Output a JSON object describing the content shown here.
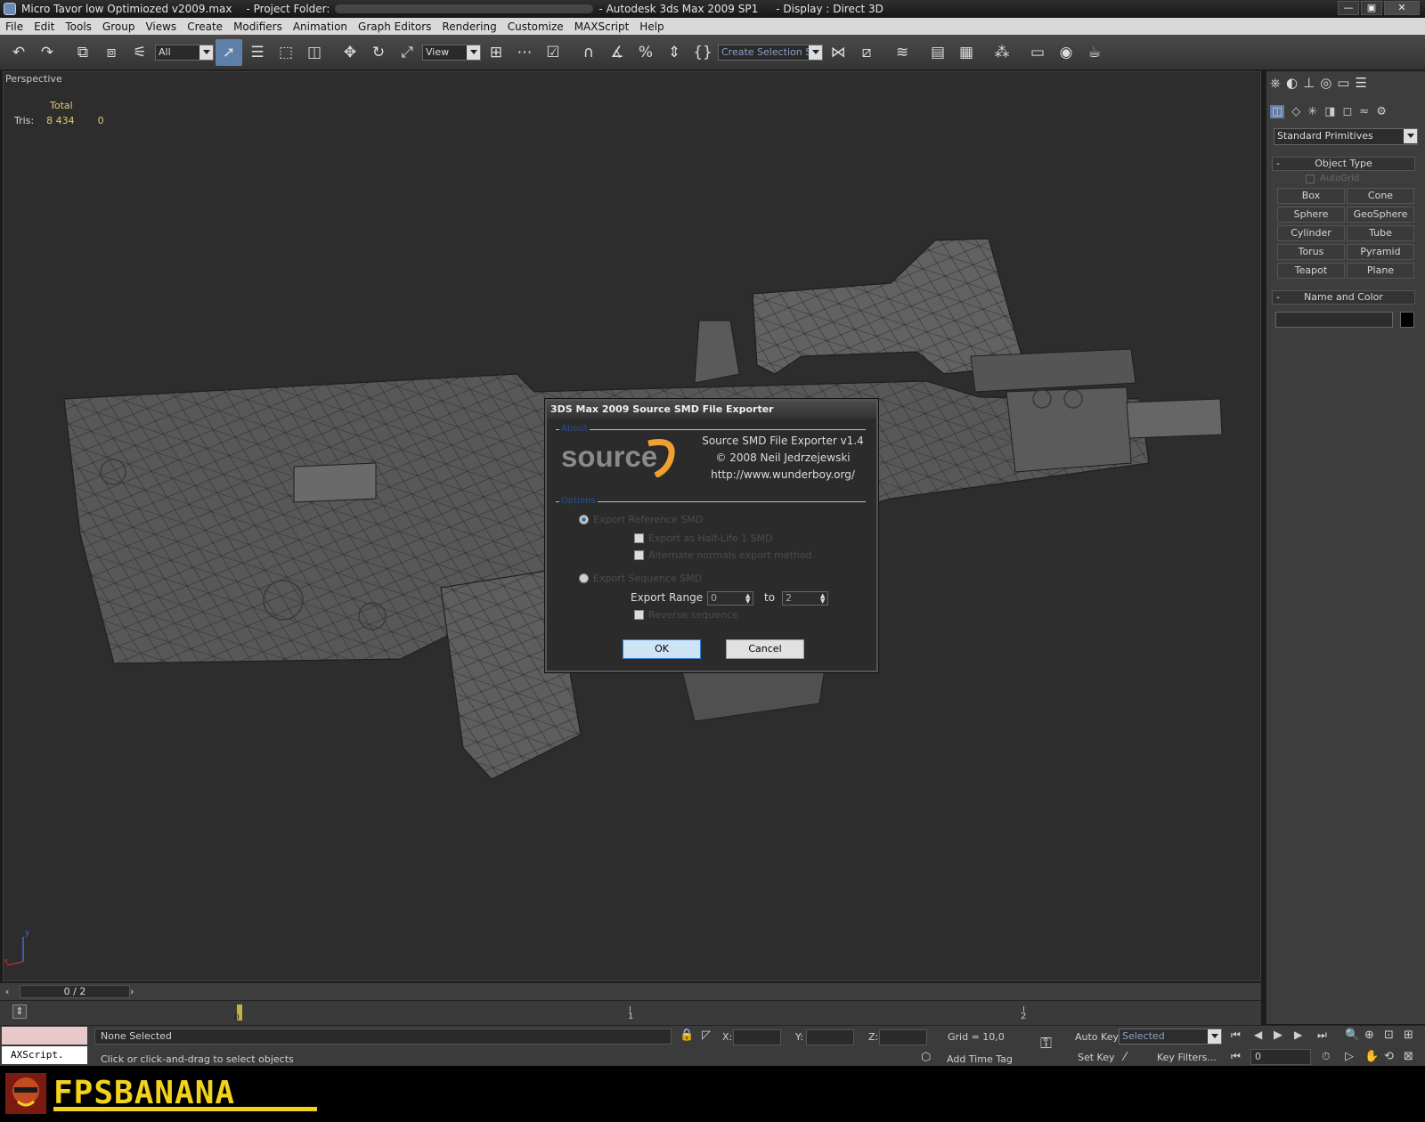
{
  "window": {
    "title": "Micro Tavor low Optimiozed v2009.max",
    "project_label": "- Project Folder:",
    "app": "- Autodesk 3ds Max  2009 SP1",
    "display": "- Display : Direct 3D",
    "controls": [
      "—",
      "▣",
      "✕"
    ]
  },
  "menu": [
    "File",
    "Edit",
    "Tools",
    "Group",
    "Views",
    "Create",
    "Modifiers",
    "Animation",
    "Graph Editors",
    "Rendering",
    "Customize",
    "MAXScript",
    "Help"
  ],
  "toolbar": {
    "filter_value": "All",
    "view_value": "View",
    "selection_set_placeholder": "Create Selection Set"
  },
  "viewport": {
    "label": "Perspective",
    "stats": {
      "header": "Total",
      "tris_label": "Tris:",
      "tris_value": "8 434",
      "tris_sel": "0"
    },
    "axis": {
      "x": "x",
      "y": "y"
    }
  },
  "timeline": {
    "frame": "0 / 2",
    "ticks": [
      "0",
      "1",
      "2"
    ]
  },
  "status": {
    "selection": "None Selected",
    "prompt": "Click or click-and-drag to select objects",
    "maxscript": "AXScript.",
    "x_label": "X:",
    "y_label": "Y:",
    "z_label": "Z:",
    "grid": "Grid = 10,0",
    "add_time_tag": "Add Time Tag",
    "auto_key": "Auto Key",
    "set_key": "Set Key",
    "key_mode": "Selected",
    "key_filters": "Key Filters...",
    "frame_field": "0"
  },
  "command_panel": {
    "category": "Standard Primitives",
    "object_type_title": "Object Type",
    "autogrid": "AutoGrid",
    "buttons": [
      "Box",
      "Cone",
      "Sphere",
      "GeoSphere",
      "Cylinder",
      "Tube",
      "Torus",
      "Pyramid",
      "Teapot",
      "Plane"
    ],
    "name_color_title": "Name and Color",
    "collapse": "-"
  },
  "dialog": {
    "title": "3DS Max 2009 Source SMD File Exporter",
    "about_group": "About",
    "logo_text": "source",
    "product": "Source SMD File Exporter v1.4",
    "copyright": "© 2008 Neil Jedrzejewski",
    "url": "http://www.wunderboy.org/",
    "options_group": "Options",
    "radio_reference": "Export Reference SMD",
    "chk_halflife": "Export as Half-Life 1 SMD",
    "chk_normals": "Alternate normals export method",
    "radio_sequence": "Export Sequence SMD",
    "range_label": "Export Range",
    "range_from": "0",
    "range_to_label": "to",
    "range_to": "2",
    "chk_reverse": "Reverse sequence",
    "ok": "OK",
    "cancel": "Cancel"
  },
  "footer": {
    "logo": "FPSBANANA"
  },
  "colors": {
    "accent": "#5e7fa8",
    "logo_yellow": "#f2d21a",
    "ok_button": "#cfe3f7"
  }
}
